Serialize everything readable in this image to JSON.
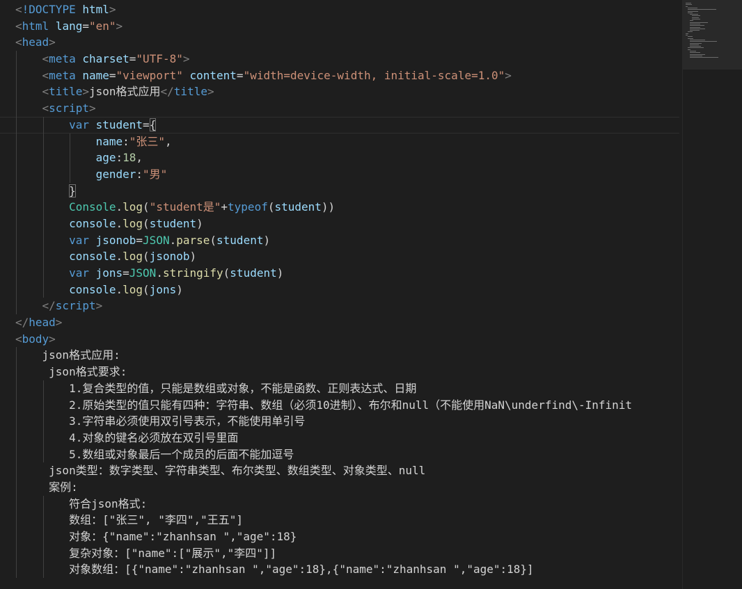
{
  "editor": {
    "colors": {
      "background": "#1e1e1e",
      "tag": "#569cd6",
      "attribute": "#9cdcfe",
      "string": "#ce9178",
      "number": "#b5cea8",
      "class": "#4ec9b0",
      "function": "#dcdcaa",
      "punctuation": "#808080",
      "text": "#d4d4d4"
    },
    "current_line": 7,
    "lines": [
      {
        "indent": 0,
        "tokens": [
          {
            "t": "punct",
            "v": "<"
          },
          {
            "t": "tag",
            "v": "!DOCTYPE"
          },
          {
            "t": "text",
            "v": " "
          },
          {
            "t": "attr",
            "v": "html"
          },
          {
            "t": "punct",
            "v": ">"
          }
        ]
      },
      {
        "indent": 0,
        "tokens": [
          {
            "t": "punct",
            "v": "<"
          },
          {
            "t": "tag",
            "v": "html"
          },
          {
            "t": "text",
            "v": " "
          },
          {
            "t": "attr",
            "v": "lang"
          },
          {
            "t": "text",
            "v": "="
          },
          {
            "t": "str",
            "v": "\"en\""
          },
          {
            "t": "punct",
            "v": ">"
          }
        ]
      },
      {
        "indent": 0,
        "tokens": [
          {
            "t": "punct",
            "v": "<"
          },
          {
            "t": "tag",
            "v": "head"
          },
          {
            "t": "punct",
            "v": ">"
          }
        ]
      },
      {
        "indent": 1,
        "tokens": [
          {
            "t": "punct",
            "v": "<"
          },
          {
            "t": "tag",
            "v": "meta"
          },
          {
            "t": "text",
            "v": " "
          },
          {
            "t": "attr",
            "v": "charset"
          },
          {
            "t": "text",
            "v": "="
          },
          {
            "t": "str",
            "v": "\"UTF-8\""
          },
          {
            "t": "punct",
            "v": ">"
          }
        ]
      },
      {
        "indent": 1,
        "tokens": [
          {
            "t": "punct",
            "v": "<"
          },
          {
            "t": "tag",
            "v": "meta"
          },
          {
            "t": "text",
            "v": " "
          },
          {
            "t": "attr",
            "v": "name"
          },
          {
            "t": "text",
            "v": "="
          },
          {
            "t": "str",
            "v": "\"viewport\""
          },
          {
            "t": "text",
            "v": " "
          },
          {
            "t": "attr",
            "v": "content"
          },
          {
            "t": "text",
            "v": "="
          },
          {
            "t": "str",
            "v": "\"width=device-width, initial-scale=1.0\""
          },
          {
            "t": "punct",
            "v": ">"
          }
        ]
      },
      {
        "indent": 1,
        "tokens": [
          {
            "t": "punct",
            "v": "<"
          },
          {
            "t": "tag",
            "v": "title"
          },
          {
            "t": "punct",
            "v": ">"
          },
          {
            "t": "text",
            "v": "json格式应用"
          },
          {
            "t": "punct",
            "v": "</"
          },
          {
            "t": "tag",
            "v": "title"
          },
          {
            "t": "punct",
            "v": ">"
          }
        ]
      },
      {
        "indent": 1,
        "tokens": [
          {
            "t": "punct",
            "v": "<"
          },
          {
            "t": "tag",
            "v": "script"
          },
          {
            "t": "punct",
            "v": ">"
          }
        ]
      },
      {
        "indent": 2,
        "tokens": [
          {
            "t": "kw",
            "v": "var"
          },
          {
            "t": "text",
            "v": " "
          },
          {
            "t": "var",
            "v": "student"
          },
          {
            "t": "text",
            "v": "="
          },
          {
            "t": "bracket",
            "v": "{"
          }
        ]
      },
      {
        "indent": 3,
        "tokens": [
          {
            "t": "var",
            "v": "name"
          },
          {
            "t": "text",
            "v": ":"
          },
          {
            "t": "str",
            "v": "\"张三\""
          },
          {
            "t": "text",
            "v": ","
          }
        ]
      },
      {
        "indent": 3,
        "tokens": [
          {
            "t": "var",
            "v": "age"
          },
          {
            "t": "text",
            "v": ":"
          },
          {
            "t": "num",
            "v": "18"
          },
          {
            "t": "text",
            "v": ","
          }
        ]
      },
      {
        "indent": 3,
        "tokens": [
          {
            "t": "var",
            "v": "gender"
          },
          {
            "t": "text",
            "v": ":"
          },
          {
            "t": "str",
            "v": "\"男\""
          }
        ]
      },
      {
        "indent": 2,
        "tokens": [
          {
            "t": "bracket",
            "v": "}"
          }
        ]
      },
      {
        "indent": 2,
        "tokens": [
          {
            "t": "class",
            "v": "Console"
          },
          {
            "t": "text",
            "v": "."
          },
          {
            "t": "fn",
            "v": "log"
          },
          {
            "t": "text",
            "v": "("
          },
          {
            "t": "str",
            "v": "\"student是\""
          },
          {
            "t": "text",
            "v": "+"
          },
          {
            "t": "kw",
            "v": "typeof"
          },
          {
            "t": "text",
            "v": "("
          },
          {
            "t": "var",
            "v": "student"
          },
          {
            "t": "text",
            "v": "))"
          }
        ]
      },
      {
        "indent": 2,
        "tokens": [
          {
            "t": "var",
            "v": "console"
          },
          {
            "t": "text",
            "v": "."
          },
          {
            "t": "fn",
            "v": "log"
          },
          {
            "t": "text",
            "v": "("
          },
          {
            "t": "var",
            "v": "student"
          },
          {
            "t": "text",
            "v": ")"
          }
        ]
      },
      {
        "indent": 2,
        "tokens": [
          {
            "t": "kw",
            "v": "var"
          },
          {
            "t": "text",
            "v": " "
          },
          {
            "t": "var",
            "v": "jsonob"
          },
          {
            "t": "text",
            "v": "="
          },
          {
            "t": "class",
            "v": "JSON"
          },
          {
            "t": "text",
            "v": "."
          },
          {
            "t": "fn",
            "v": "parse"
          },
          {
            "t": "text",
            "v": "("
          },
          {
            "t": "var",
            "v": "student"
          },
          {
            "t": "text",
            "v": ")"
          }
        ]
      },
      {
        "indent": 2,
        "tokens": [
          {
            "t": "var",
            "v": "console"
          },
          {
            "t": "text",
            "v": "."
          },
          {
            "t": "fn",
            "v": "log"
          },
          {
            "t": "text",
            "v": "("
          },
          {
            "t": "var",
            "v": "jsonob"
          },
          {
            "t": "text",
            "v": ")"
          }
        ]
      },
      {
        "indent": 2,
        "tokens": [
          {
            "t": "kw",
            "v": "var"
          },
          {
            "t": "text",
            "v": " "
          },
          {
            "t": "var",
            "v": "jons"
          },
          {
            "t": "text",
            "v": "="
          },
          {
            "t": "class",
            "v": "JSON"
          },
          {
            "t": "text",
            "v": "."
          },
          {
            "t": "fn",
            "v": "stringify"
          },
          {
            "t": "text",
            "v": "("
          },
          {
            "t": "var",
            "v": "student"
          },
          {
            "t": "text",
            "v": ")"
          }
        ]
      },
      {
        "indent": 2,
        "tokens": [
          {
            "t": "var",
            "v": "console"
          },
          {
            "t": "text",
            "v": "."
          },
          {
            "t": "fn",
            "v": "log"
          },
          {
            "t": "text",
            "v": "("
          },
          {
            "t": "var",
            "v": "jons"
          },
          {
            "t": "text",
            "v": ")"
          }
        ]
      },
      {
        "indent": 1,
        "tokens": [
          {
            "t": "punct",
            "v": "</"
          },
          {
            "t": "tag",
            "v": "script"
          },
          {
            "t": "punct",
            "v": ">"
          }
        ]
      },
      {
        "indent": 0,
        "tokens": [
          {
            "t": "punct",
            "v": "</"
          },
          {
            "t": "tag",
            "v": "head"
          },
          {
            "t": "punct",
            "v": ">"
          }
        ]
      },
      {
        "indent": 0,
        "tokens": [
          {
            "t": "punct",
            "v": "<"
          },
          {
            "t": "tag",
            "v": "body"
          },
          {
            "t": "punct",
            "v": ">"
          }
        ]
      },
      {
        "indent": 1,
        "tokens": [
          {
            "t": "text",
            "v": "json格式应用:"
          }
        ]
      },
      {
        "indent": 1,
        "tokens": [
          {
            "t": "text",
            "v": " json格式要求:"
          }
        ]
      },
      {
        "indent": 2,
        "tokens": [
          {
            "t": "text",
            "v": "1.复合类型的值，只能是数组或对象，不能是函数、正则表达式、日期"
          }
        ]
      },
      {
        "indent": 2,
        "tokens": [
          {
            "t": "text",
            "v": "2.原始类型的值只能有四种：字符串、数组（必须10进制）、布尔和null（不能使用NaN\\underfind\\-Infinit"
          }
        ]
      },
      {
        "indent": 2,
        "tokens": [
          {
            "t": "text",
            "v": "3.字符串必须使用双引号表示，不能使用单引号"
          }
        ]
      },
      {
        "indent": 2,
        "tokens": [
          {
            "t": "text",
            "v": "4.对象的键名必须放在双引号里面"
          }
        ]
      },
      {
        "indent": 2,
        "tokens": [
          {
            "t": "text",
            "v": "5.数组或对象最后一个成员的后面不能加逗号"
          }
        ]
      },
      {
        "indent": 1,
        "tokens": [
          {
            "t": "text",
            "v": " json类型：数字类型、字符串类型、布尔类型、数组类型、对象类型、null"
          }
        ]
      },
      {
        "indent": 1,
        "tokens": [
          {
            "t": "text",
            "v": " 案例:"
          }
        ]
      },
      {
        "indent": 2,
        "tokens": [
          {
            "t": "text",
            "v": "符合json格式:"
          }
        ]
      },
      {
        "indent": 2,
        "tokens": [
          {
            "t": "text",
            "v": "数组：[\"张三\", \"李四\",\"王五\"]"
          }
        ]
      },
      {
        "indent": 2,
        "tokens": [
          {
            "t": "text",
            "v": "对象：{\"name\":\"zhanhsan \",\"age\":18}"
          }
        ]
      },
      {
        "indent": 2,
        "tokens": [
          {
            "t": "text",
            "v": "复杂对象：[\"name\":[\"展示\",\"李四\"]]"
          }
        ]
      },
      {
        "indent": 2,
        "tokens": [
          {
            "t": "text",
            "v": "对象数组：[{\"name\":\"zhanhsan \",\"age\":18},{\"name\":\"zhanhsan \",\"age\":18}]"
          }
        ]
      }
    ]
  }
}
